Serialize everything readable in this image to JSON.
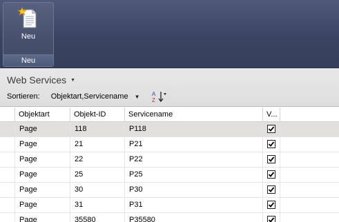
{
  "ribbon": {
    "new_button": {
      "label": "Neu",
      "icon": "new-document-icon"
    },
    "group_label": "Neu"
  },
  "section": {
    "title": "Web Services",
    "sort_label": "Sortieren:",
    "sort_value": "Objektart,Servicename",
    "sort_icon": "sort-az-icon"
  },
  "grid": {
    "columns": [
      "Objektart",
      "Objekt-ID",
      "Servicename",
      "V..."
    ],
    "rows": [
      {
        "objektart": "Page",
        "objekt_id": "118",
        "servicename": "P118",
        "checked": true,
        "selected": true
      },
      {
        "objektart": "Page",
        "objekt_id": "21",
        "servicename": "P21",
        "checked": true,
        "selected": false
      },
      {
        "objektart": "Page",
        "objekt_id": "22",
        "servicename": "P22",
        "checked": true,
        "selected": false
      },
      {
        "objektart": "Page",
        "objekt_id": "25",
        "servicename": "P25",
        "checked": true,
        "selected": false
      },
      {
        "objektart": "Page",
        "objekt_id": "30",
        "servicename": "P30",
        "checked": true,
        "selected": false
      },
      {
        "objektart": "Page",
        "objekt_id": "31",
        "servicename": "P31",
        "checked": true,
        "selected": false
      },
      {
        "objektart": "Page",
        "objekt_id": "35580",
        "servicename": "P35580",
        "checked": true,
        "selected": false
      }
    ]
  },
  "colors": {
    "ribbon_bg": "#3b4563",
    "selected_row": "#e2e0dc",
    "header_bg": "#e4e4e4"
  }
}
